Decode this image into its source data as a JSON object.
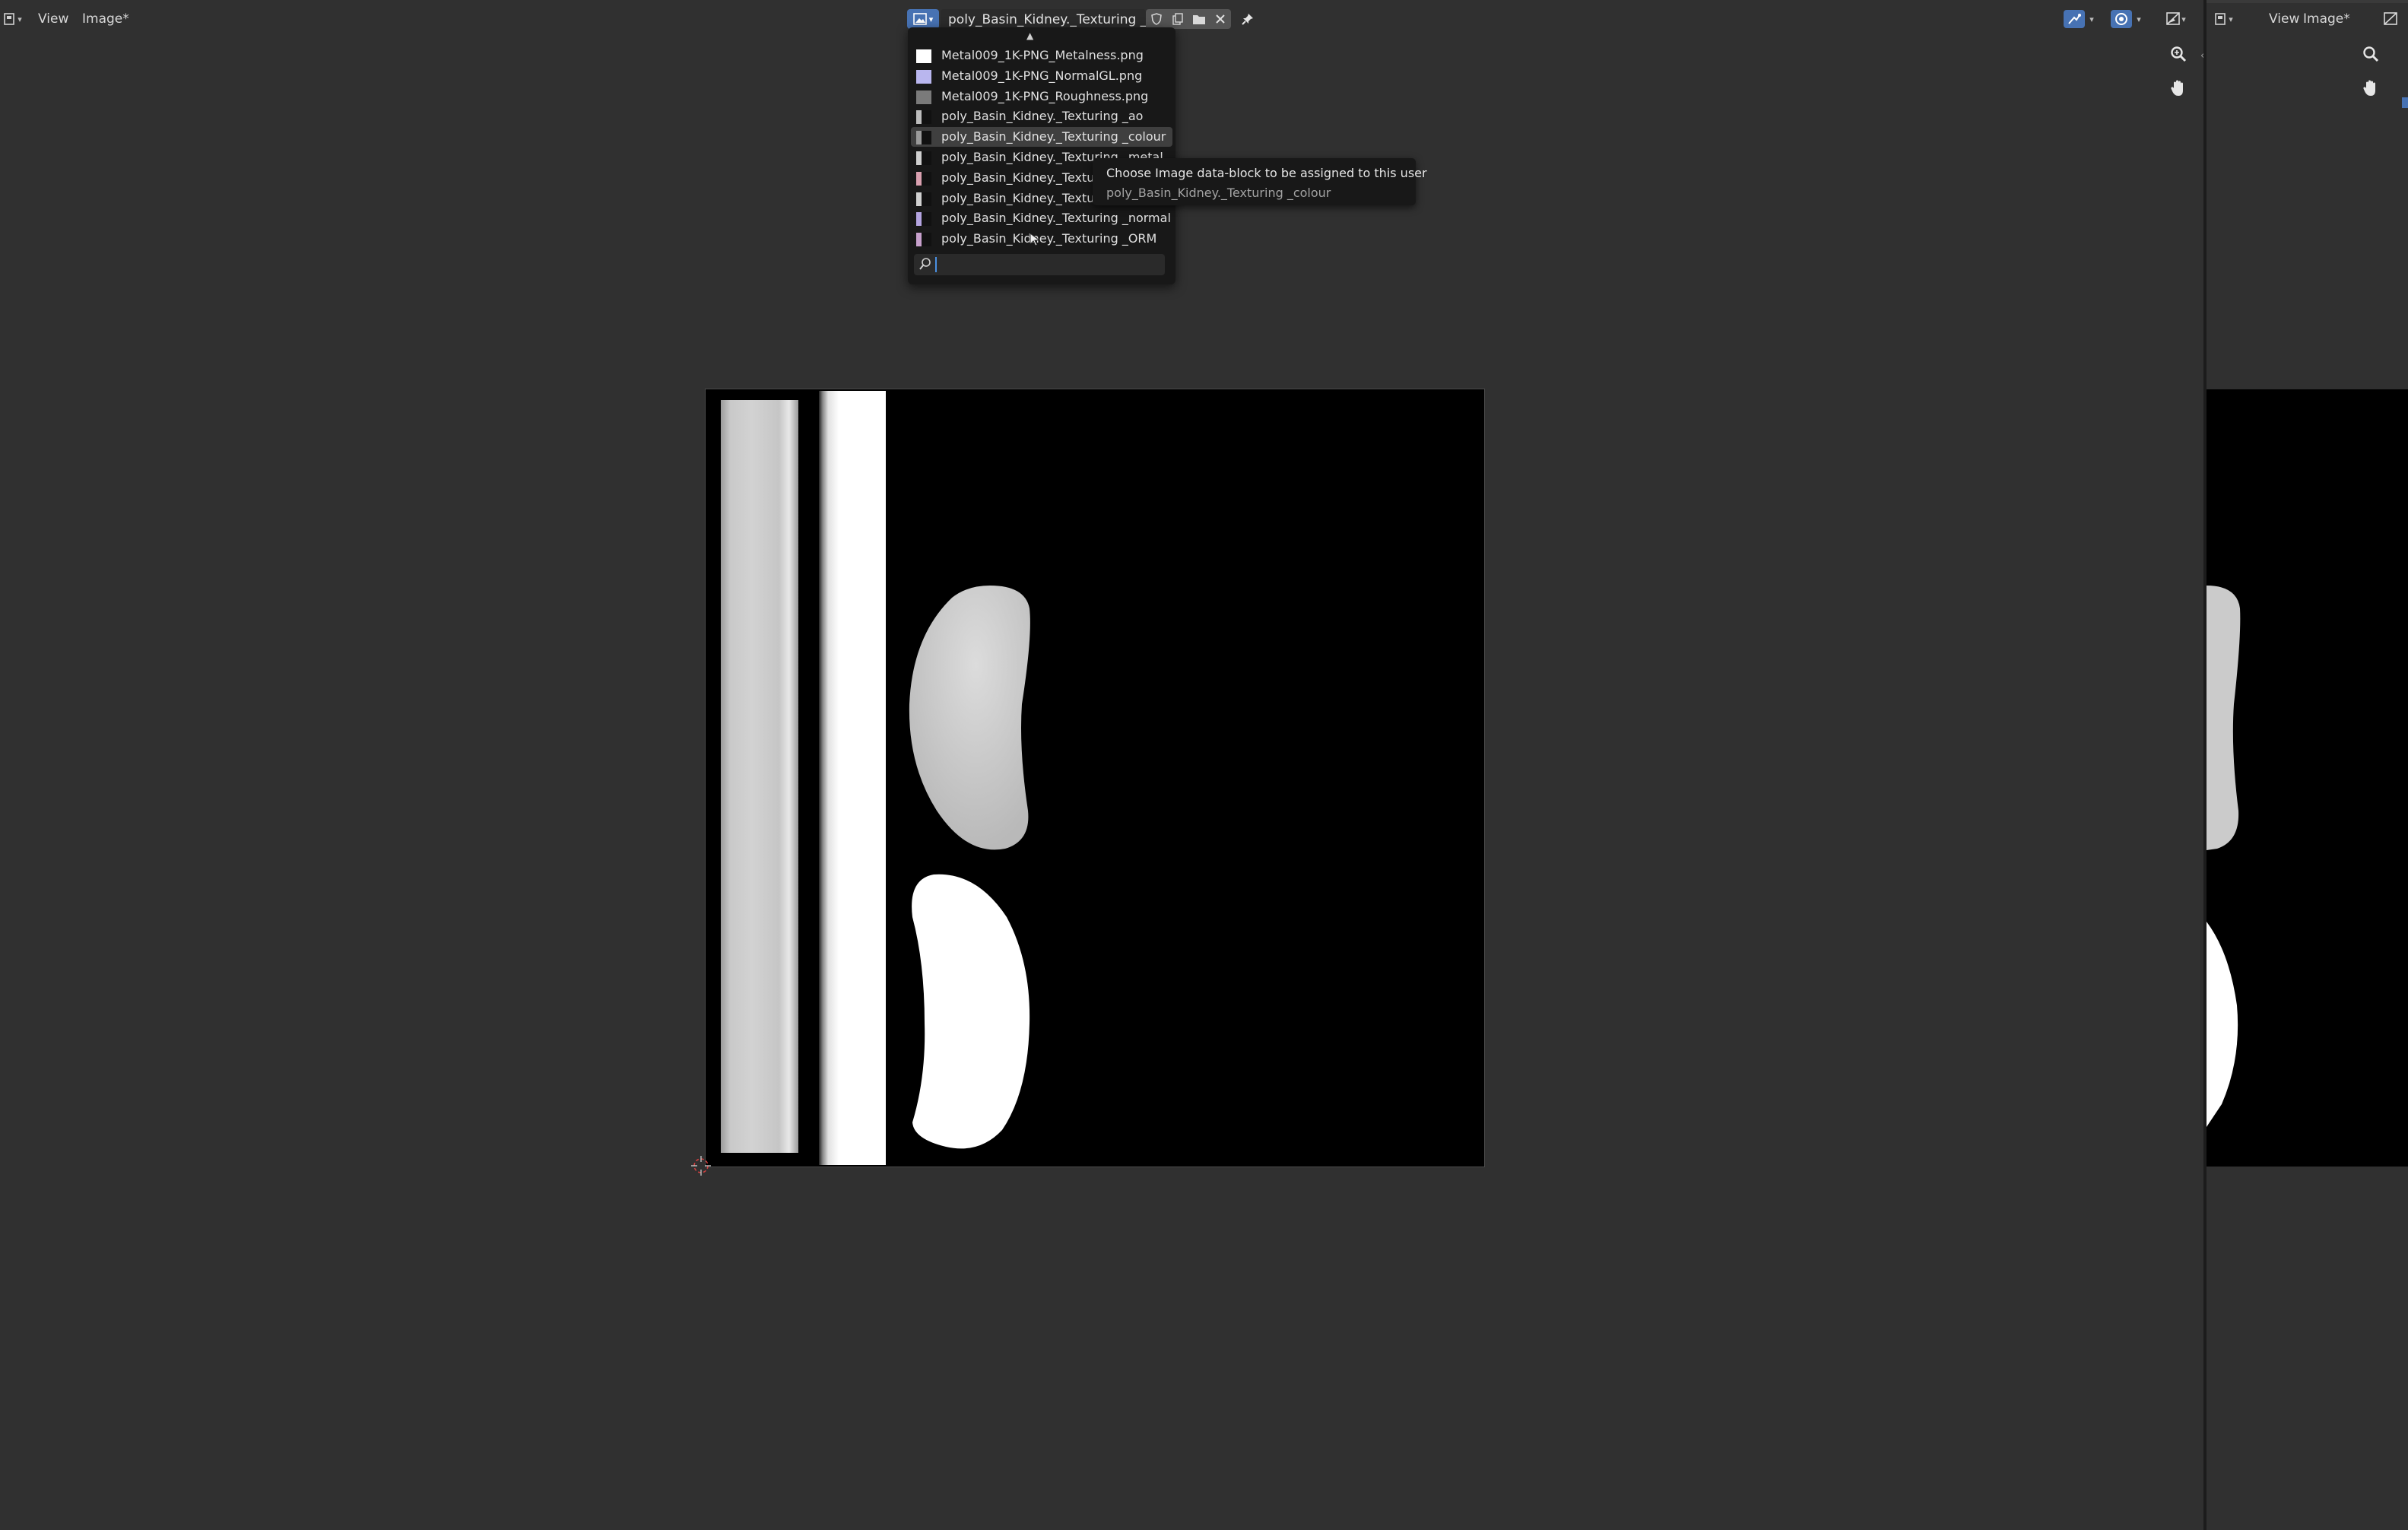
{
  "main_header": {
    "menu_view": "View",
    "menu_image": "Image*",
    "image_name": "poly_Basin_Kidney._Texturing _ao"
  },
  "side_header": {
    "menu_view": "View",
    "menu_image": "Image*"
  },
  "image_dropdown": {
    "items": [
      {
        "label": "Metal009_1K-PNG_Metalness.png",
        "thumb": "#ffffff"
      },
      {
        "label": "Metal009_1K-PNG_NormalGL.png",
        "thumb": "#b9b6ee"
      },
      {
        "label": "Metal009_1K-PNG_Roughness.png",
        "thumb": "#7a7a7a"
      },
      {
        "label": "poly_Basin_Kidney._Texturing _ao",
        "thumb": "#bdbdbd"
      },
      {
        "label": "poly_Basin_Kidney._Texturing _colour",
        "thumb": "#9a9a9a",
        "active": true
      },
      {
        "label": "poly_Basin_Kidney._Texturing _metal",
        "thumb": "#cfcfcf"
      },
      {
        "label": "poly_Basin_Kidney._Textu",
        "thumb": "#d9a0b0"
      },
      {
        "label": "poly_Basin_Kidney._Textu",
        "thumb": "#d0d0d0"
      },
      {
        "label": "poly_Basin_Kidney._Texturing _normal",
        "thumb": "#b4a4e0"
      },
      {
        "label": "poly_Basin_Kidney._Texturing _ORM",
        "thumb": "#c7a0cc"
      }
    ],
    "search_value": ""
  },
  "tooltip": {
    "text": "Choose Image data-block to be assigned to this user",
    "value": "poly_Basin_Kidney._Texturing _colour"
  },
  "colors": {
    "accent": "#4772b3",
    "background": "#303030",
    "popup": "#181818"
  }
}
